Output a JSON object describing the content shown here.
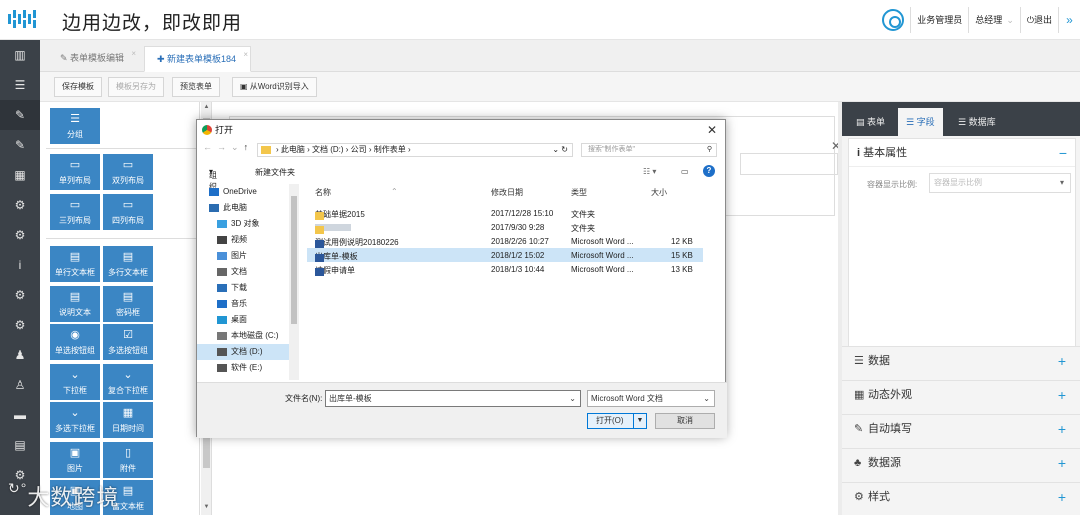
{
  "app": {
    "title": "边用边改，即改即用",
    "colors": {
      "accent": "#2196d3",
      "sidebar": "#3b4148",
      "palette_button": "#3b86c4"
    }
  },
  "header": {
    "user_role": "业务管理员",
    "user_name": "总经理",
    "logout": "退出",
    "settings_icon": "gear-icon",
    "collapse_icon": "double-chevron-icon"
  },
  "sidenav": {
    "items": [
      {
        "icon": "grid-icon",
        "glyph": "▥"
      },
      {
        "icon": "menu-icon",
        "glyph": "☰"
      },
      {
        "icon": "edit-icon",
        "glyph": "✎"
      },
      {
        "icon": "edit-alt-icon",
        "glyph": "✎"
      },
      {
        "icon": "table-icon",
        "glyph": "▦"
      },
      {
        "icon": "cog-icon",
        "glyph": "⚙"
      },
      {
        "icon": "cog-icon-2",
        "glyph": "⚙"
      },
      {
        "icon": "info-icon",
        "glyph": "i"
      },
      {
        "icon": "cog-icon-3",
        "glyph": "⚙"
      },
      {
        "icon": "cog-icon-4",
        "glyph": "⚙"
      },
      {
        "icon": "users-icon",
        "glyph": "♟"
      },
      {
        "icon": "user-icon",
        "glyph": "♙"
      },
      {
        "icon": "folder-icon",
        "glyph": "▬"
      },
      {
        "icon": "list-icon",
        "glyph": "▤"
      },
      {
        "icon": "cog-icon-5",
        "glyph": "⚙"
      }
    ]
  },
  "tabs": [
    {
      "label": "表单模板编辑",
      "icon": "edit-icon"
    },
    {
      "label": "新建表单模板184",
      "icon": "plus-icon"
    }
  ],
  "toolbar": {
    "save": "保存模板",
    "save_as": "模板另存为",
    "preview": "预览表单",
    "import_word": "从Word识别导入"
  },
  "palette": {
    "group": "分组",
    "items": [
      {
        "label": "单列布局",
        "glyph": "▭"
      },
      {
        "label": "双列布局",
        "glyph": "▭"
      },
      {
        "label": "三列布局",
        "glyph": "▭"
      },
      {
        "label": "四列布局",
        "glyph": "▭"
      },
      {
        "label": "单行文本框",
        "glyph": "▤"
      },
      {
        "label": "多行文本框",
        "glyph": "▤"
      },
      {
        "label": "说明文本",
        "glyph": "▤"
      },
      {
        "label": "密码框",
        "glyph": "▤"
      },
      {
        "label": "单选按钮组",
        "glyph": "◉"
      },
      {
        "label": "多选按钮组",
        "glyph": "☑"
      },
      {
        "label": "下拉框",
        "glyph": "⌄"
      },
      {
        "label": "复合下拉框",
        "glyph": "⌄"
      },
      {
        "label": "多选下拉框",
        "glyph": "⌄"
      },
      {
        "label": "日期时间",
        "glyph": "▦"
      },
      {
        "label": "图片",
        "glyph": "▣"
      },
      {
        "label": "附件",
        "glyph": "▯"
      },
      {
        "label": "地图",
        "glyph": "▣"
      },
      {
        "label": "富文本框",
        "glyph": "▤"
      }
    ]
  },
  "right_panel": {
    "tabs": [
      "表单",
      "字段",
      "数据库"
    ],
    "basic_title": "基本属性",
    "ratio_label": "容器显示比例:",
    "ratio_placeholder": "容器显示比例",
    "sections": [
      "数据",
      "动态外观",
      "自动填写",
      "数据源",
      "样式"
    ]
  },
  "dialog": {
    "title": "打开",
    "breadcrumb": [
      "此电脑",
      "文档 (D:)",
      "公司",
      "制作表单"
    ],
    "search_placeholder": "搜索\"制作表单\"",
    "organize": "组织",
    "new_folder": "新建文件夹",
    "tree": [
      "OneDrive",
      "此电脑",
      "3D 对象",
      "视频",
      "图片",
      "文档",
      "下载",
      "音乐",
      "桌面",
      "本地磁盘 (C:)",
      "文档 (D:)",
      "软件 (E:)"
    ],
    "columns": [
      "名称",
      "修改日期",
      "类型",
      "大小"
    ],
    "files": [
      {
        "name": "基础单据2015",
        "date": "2017/12/28 15:10",
        "type": "文件夹",
        "size": "",
        "kind": "folder"
      },
      {
        "name": "",
        "date": "2017/9/30 9:28",
        "type": "文件夹",
        "size": "",
        "kind": "folder"
      },
      {
        "name": "测试用例说明20180226",
        "date": "2018/2/26 10:27",
        "type": "Microsoft Word ...",
        "size": "12 KB",
        "kind": "doc"
      },
      {
        "name": "出库单-模板",
        "date": "2018/1/2 15:02",
        "type": "Microsoft Word ...",
        "size": "15 KB",
        "kind": "doc"
      },
      {
        "name": "请假申请单",
        "date": "2018/1/3 10:44",
        "type": "Microsoft Word ...",
        "size": "13 KB",
        "kind": "doc"
      }
    ],
    "filename_label": "文件名(N):",
    "filename_value": "出库单-模板",
    "filetype": "Microsoft Word 文档",
    "open": "打开(O)",
    "cancel": "取消"
  },
  "watermark": "大数跨境"
}
